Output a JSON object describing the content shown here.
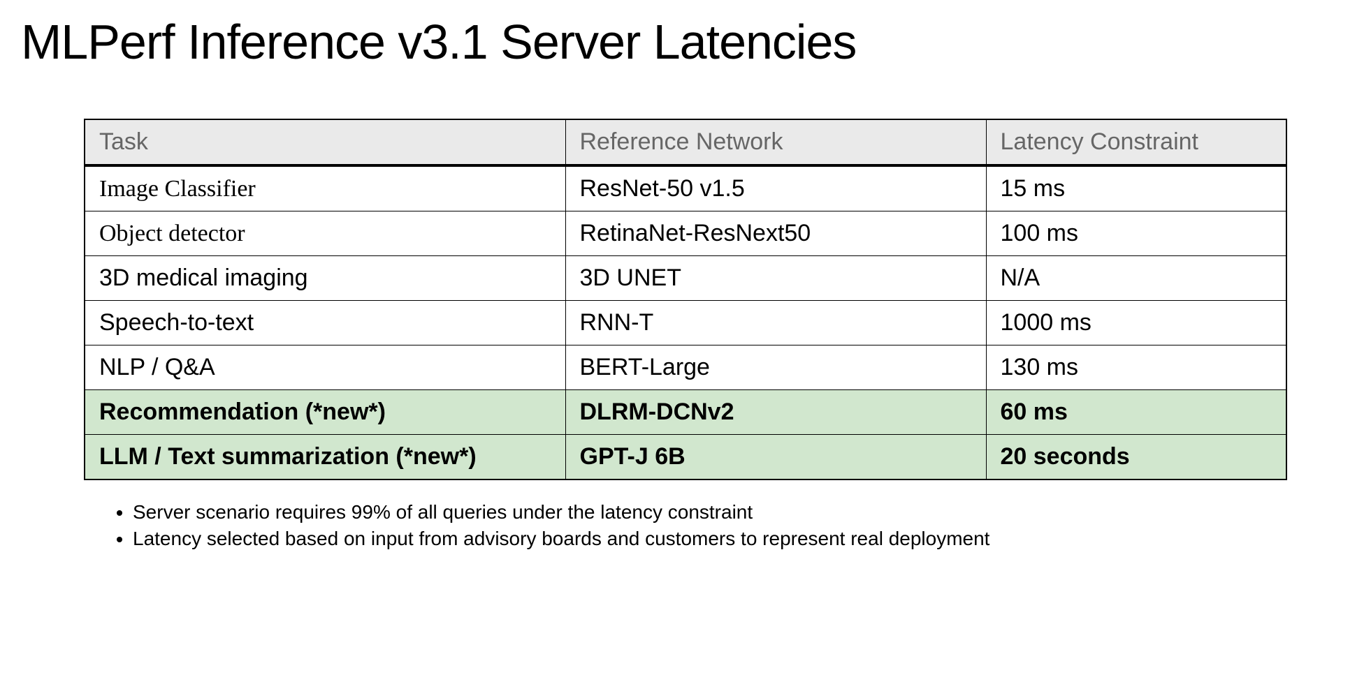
{
  "title": "MLPerf Inference v3.1 Server Latencies",
  "headers": {
    "task": "Task",
    "network": "Reference Network",
    "latency": "Latency Constraint"
  },
  "rows": [
    {
      "task": "Image Classifier",
      "network": "ResNet-50 v1.5",
      "latency": "15 ms",
      "serif_task": true
    },
    {
      "task": "Object detector",
      "network": "RetinaNet-ResNext50",
      "latency": "100 ms",
      "serif_task": true
    },
    {
      "task": "3D medical imaging",
      "network": "3D UNET",
      "latency": "N/A"
    },
    {
      "task": "Speech-to-text",
      "network": "RNN-T",
      "latency": "1000 ms"
    },
    {
      "task": "NLP / Q&A",
      "network": "BERT-Large",
      "latency": "130 ms"
    },
    {
      "task": "Recommendation (*new*)",
      "network": "DLRM-DCNv2",
      "latency": "60 ms",
      "highlight": true
    },
    {
      "task": "LLM / Text summarization (*new*)",
      "network": "GPT-J 6B",
      "latency": "20 seconds",
      "highlight": true
    }
  ],
  "notes": [
    "Server scenario requires 99% of all queries under the latency constraint",
    "Latency selected based on input from advisory boards and customers to represent real deployment"
  ]
}
